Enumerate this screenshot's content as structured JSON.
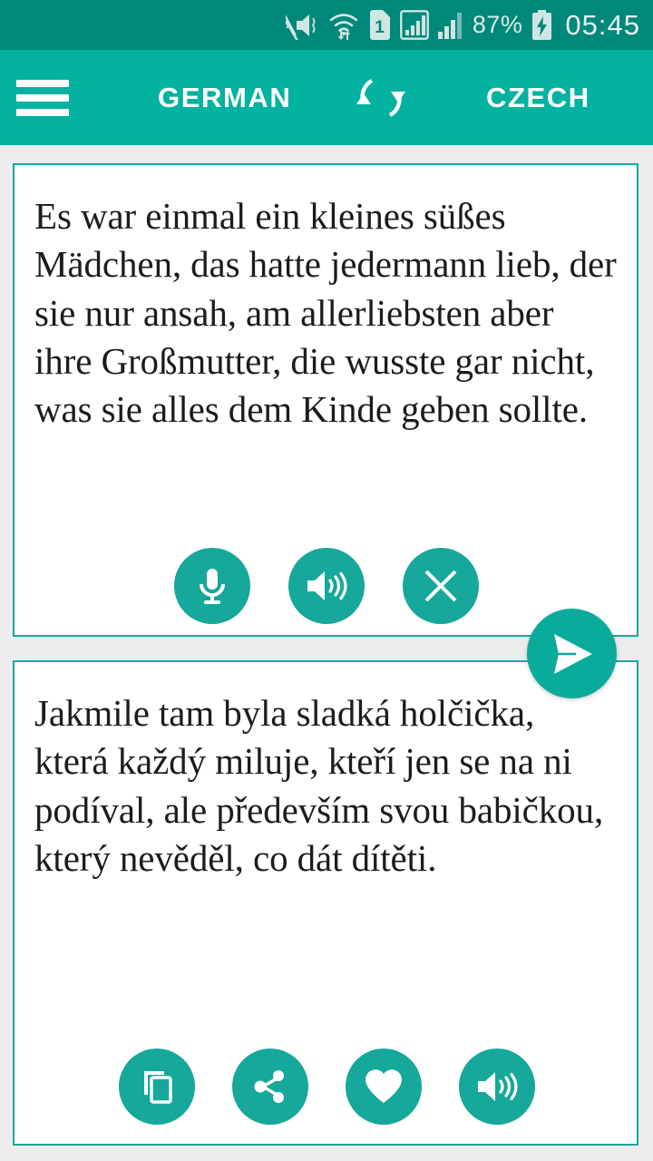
{
  "status_bar": {
    "battery_percent": "87%",
    "time": "05:45",
    "icons": [
      "vibrate-mute-icon",
      "wifi-icon",
      "sim-card-1-icon",
      "signal-boxed-icon",
      "signal-bars-icon",
      "battery-charging-icon"
    ],
    "sim_label": "1",
    "background_color": "#00887a",
    "foreground_color": "#d7ece8"
  },
  "app_bar": {
    "menu_icon": "hamburger-menu-icon",
    "source_language": "GERMAN",
    "swap_icon": "swap-languages-icon",
    "target_language": "CZECH",
    "background_color": "#03b2a0",
    "text_color": "#ffffff"
  },
  "source_card": {
    "text": "Es war einmal ein kleines süßes Mädchen, das hatte jedermann lieb, der sie nur ansah, am allerliebsten aber ihre Großmutter, die wusste gar nicht, was sie alles dem Kinde geben sollte.",
    "buttons": [
      {
        "name": "microphone-button",
        "icon": "microphone-icon"
      },
      {
        "name": "speak-source-button",
        "icon": "speaker-volume-icon"
      },
      {
        "name": "clear-text-button",
        "icon": "close-x-icon"
      }
    ],
    "border_color": "#16a89a",
    "background_color": "#ffffff"
  },
  "translate_fab": {
    "name": "translate-send-button",
    "icon": "send-paper-plane-icon",
    "color": "#0bab9b"
  },
  "target_card": {
    "text": "Jakmile tam byla sladká holčička, která každý miluje, kteří jen se na ni podíval, ale především svou babičkou, který nevěděl, co dát dítěti.",
    "buttons": [
      {
        "name": "copy-button",
        "icon": "copy-icon"
      },
      {
        "name": "share-button",
        "icon": "share-icon"
      },
      {
        "name": "favorite-button",
        "icon": "heart-icon"
      },
      {
        "name": "speak-target-button",
        "icon": "speaker-volume-icon"
      }
    ],
    "border_color": "#16a89a",
    "background_color": "#ffffff"
  },
  "theme": {
    "accent": "#16a89a",
    "app_bar": "#03b2a0",
    "status_bar": "#00887a",
    "page_background": "#ececec"
  }
}
